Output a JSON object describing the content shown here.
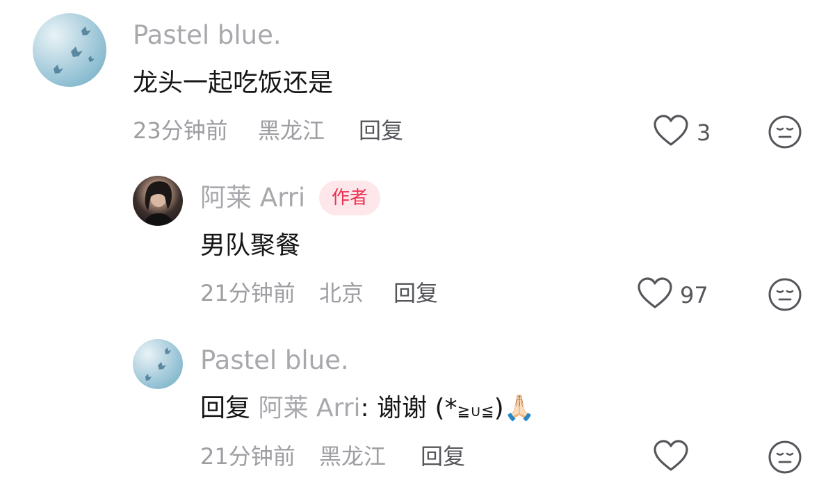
{
  "comments": [
    {
      "username": "Pastel blue.",
      "text": "龙头一起吃饭还是",
      "time": "23分钟前",
      "location": "黑龙江",
      "reply_label": "回复",
      "likes": "3",
      "like_icon": "heart-outline-icon",
      "dislike_icon": "neutral-face-icon"
    },
    {
      "username": "阿莱 Arri",
      "badge": "作者",
      "text": "男队聚餐",
      "time": "21分钟前",
      "location": "北京",
      "reply_label": "回复",
      "likes": "97",
      "like_icon": "heart-outline-icon",
      "dislike_icon": "neutral-face-icon"
    },
    {
      "username": "Pastel blue.",
      "reply_prefix": "回复",
      "mention": "阿莱 Arri",
      "text_colon": ":",
      "text": " 谢谢 (*",
      "kaomoji_inner": "≧∪≦",
      "text_tail": ")",
      "emoji": "🙏🏻",
      "time": "21分钟前",
      "location": "黑龙江",
      "reply_label": "回复",
      "likes": "",
      "like_icon": "heart-outline-icon",
      "dislike_icon": "neutral-face-icon"
    }
  ],
  "colors": {
    "username": "#a8a8ad",
    "meta": "#9d9da2",
    "badge_bg": "#fde7ea",
    "badge_text": "#ec3152"
  }
}
